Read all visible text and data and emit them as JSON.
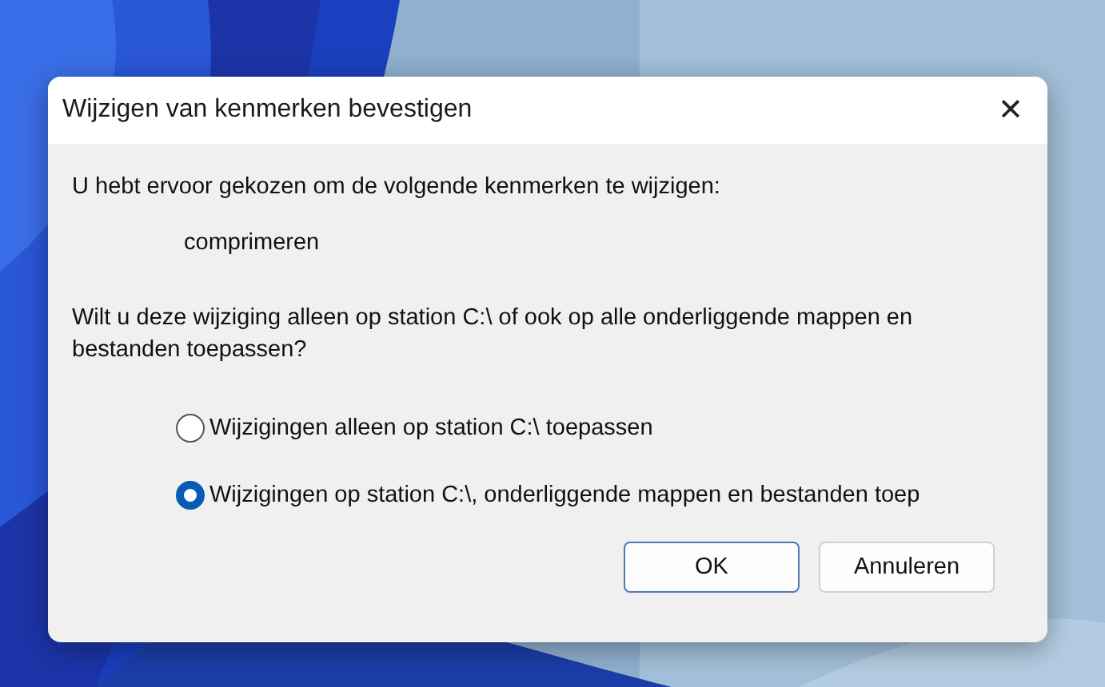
{
  "dialog": {
    "title": "Wijzigen van kenmerken bevestigen",
    "close_label": "✕",
    "message": "U hebt ervoor gekozen om de volgende kenmerken te wijzigen:",
    "attribute": "comprimeren",
    "question": "Wilt u deze wijziging alleen op station C:\\ of ook op alle onderliggende mappen en bestanden toepassen?",
    "options": [
      {
        "label": "Wijzigingen alleen op station C:\\ toepassen",
        "selected": false
      },
      {
        "label": "Wijzigingen op station C:\\, onderliggende mappen en bestanden toep",
        "selected": true
      }
    ],
    "buttons": [
      {
        "label": "OK",
        "default": true
      },
      {
        "label": "Annuleren",
        "default": false
      }
    ]
  }
}
